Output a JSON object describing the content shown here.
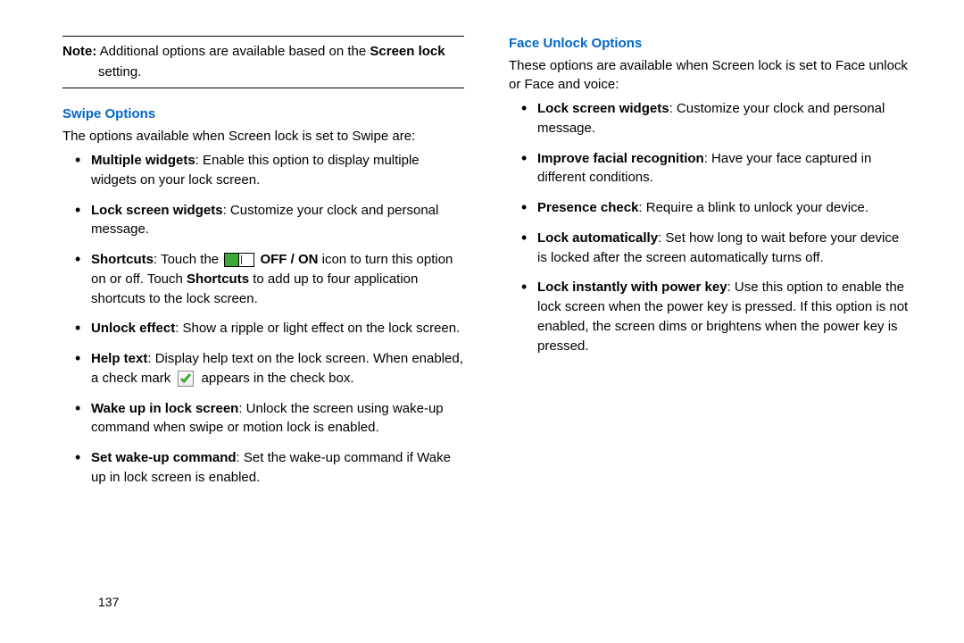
{
  "note": {
    "label": "Note:",
    "text_before": "Additional options are available based on the ",
    "bold_term": "Screen lock",
    "text_after": " setting."
  },
  "swipe": {
    "heading": "Swipe Options",
    "intro": "The options available when Screen lock is set to Swipe are:",
    "items": [
      {
        "term": "Multiple widgets",
        "desc": ": Enable this option to display multiple widgets on your lock screen."
      },
      {
        "term": "Lock screen widgets",
        "desc": ": Customize your clock and personal message."
      },
      {
        "term": "Shortcuts",
        "desc_before": ": Touch the ",
        "toggle_label": "OFF / ON",
        "desc_mid": " icon to turn this option on or off. Touch ",
        "bold_inner": "Shortcuts",
        "desc_after": " to add up to four application shortcuts to the lock screen."
      },
      {
        "term": "Unlock effect",
        "desc": ": Show a ripple or light effect on the lock screen."
      },
      {
        "term": "Help text",
        "desc_before": ": Display help text on the lock screen. When enabled, a check mark ",
        "desc_after": " appears in the check box."
      },
      {
        "term": "Wake up in lock screen",
        "desc": ": Unlock the screen using wake-up command when swipe or motion lock is enabled."
      },
      {
        "term": "Set wake-up command",
        "desc": ": Set the wake-up command if Wake up in lock screen is enabled."
      }
    ]
  },
  "face": {
    "heading": "Face Unlock Options",
    "intro": "These options are available when Screen lock is set to Face unlock or Face and voice:",
    "items": [
      {
        "term": "Lock screen widgets",
        "desc": ": Customize your clock and personal message."
      },
      {
        "term": "Improve facial recognition",
        "desc": ": Have your face captured in different conditions."
      },
      {
        "term": "Presence check",
        "desc": ": Require a blink to unlock your device."
      },
      {
        "term": "Lock automatically",
        "desc": ": Set how long to wait before your device is locked after the screen automatically turns off."
      },
      {
        "term": "Lock instantly with power key",
        "desc": ": Use this option to enable the lock screen when the power key is pressed. If this option is not enabled, the screen dims or brightens when the power key is pressed."
      }
    ]
  },
  "page_number": "137"
}
